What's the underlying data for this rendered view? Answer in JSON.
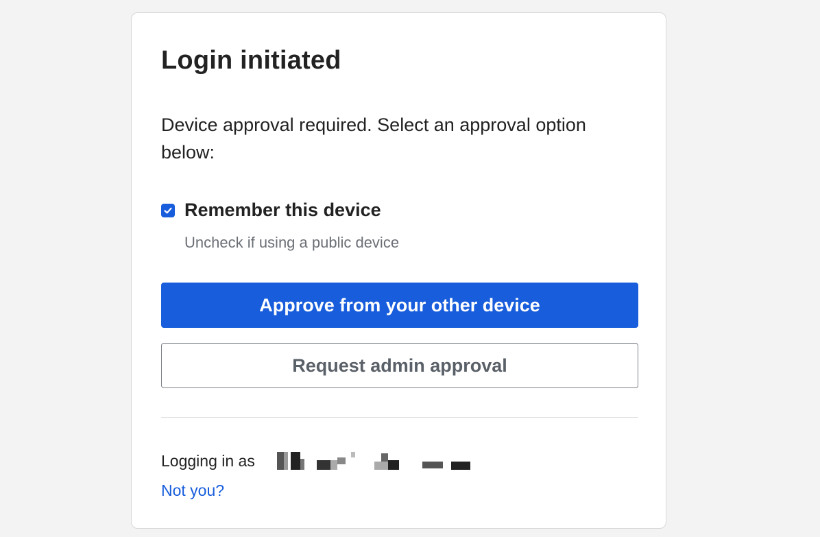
{
  "login": {
    "title": "Login initiated",
    "description": "Device approval required. Select an approval option below:",
    "remember": {
      "label": "Remember this device",
      "checked": true,
      "hint": "Uncheck if using a public device"
    },
    "approve_button": "Approve from your other device",
    "admin_button": "Request admin approval",
    "logging_in_label": "Logging in as",
    "not_you_link": "Not you?"
  },
  "colors": {
    "primary": "#175ddc",
    "hint_text": "#6b6f75"
  },
  "icons": {
    "checkbox": "checkmark-icon"
  }
}
